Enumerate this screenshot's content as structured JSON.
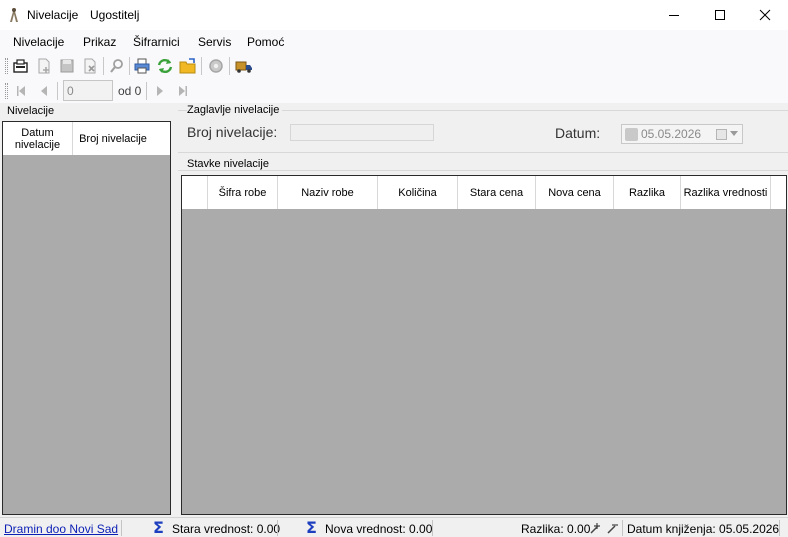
{
  "window": {
    "title": "Nivelacije",
    "subtitle": "Ugostitelj"
  },
  "menu": {
    "items": [
      "Nivelacije",
      "Prikaz",
      "Šifrarnici",
      "Servis",
      "Pomoć"
    ]
  },
  "toolbar": {
    "icons": [
      "new-document-icon",
      "add-icon",
      "save-icon",
      "delete-icon",
      "search-icon",
      "print-icon",
      "refresh-icon",
      "open-folder-icon",
      "settings-icon",
      "truck-icon"
    ]
  },
  "navigator": {
    "position_value": "0",
    "of_label": "od 0"
  },
  "left_panel": {
    "title": "Nivelacije",
    "columns": [
      "Datum nivelacije",
      "Broj nivelacije"
    ],
    "rows": []
  },
  "header_group": {
    "title": "Zaglavlje nivelacije",
    "broj_label": "Broj nivelacije:",
    "broj_value": "",
    "datum_label": "Datum:",
    "datum_value": "05.05.2026"
  },
  "items_group": {
    "title": "Stavke nivelacije",
    "columns": [
      "Šifra robe",
      "Naziv robe",
      "Količina",
      "Stara cena",
      "Nova cena",
      "Razlika",
      "Razlika vrednosti"
    ],
    "rows": []
  },
  "status": {
    "company": "Dramin doo Novi Sad",
    "stara_vrednost": "Stara vrednost: 0.00",
    "nova_vrednost": "Nova vrednost: 0.00",
    "razlika": "Razlika: 0.00",
    "datum_knjizenja": "Datum knjiženja: 05.05.2026"
  },
  "colors": {
    "grid_background": "#ababab",
    "link": "#0b1fb5",
    "sigma": "#1c3ebf"
  }
}
